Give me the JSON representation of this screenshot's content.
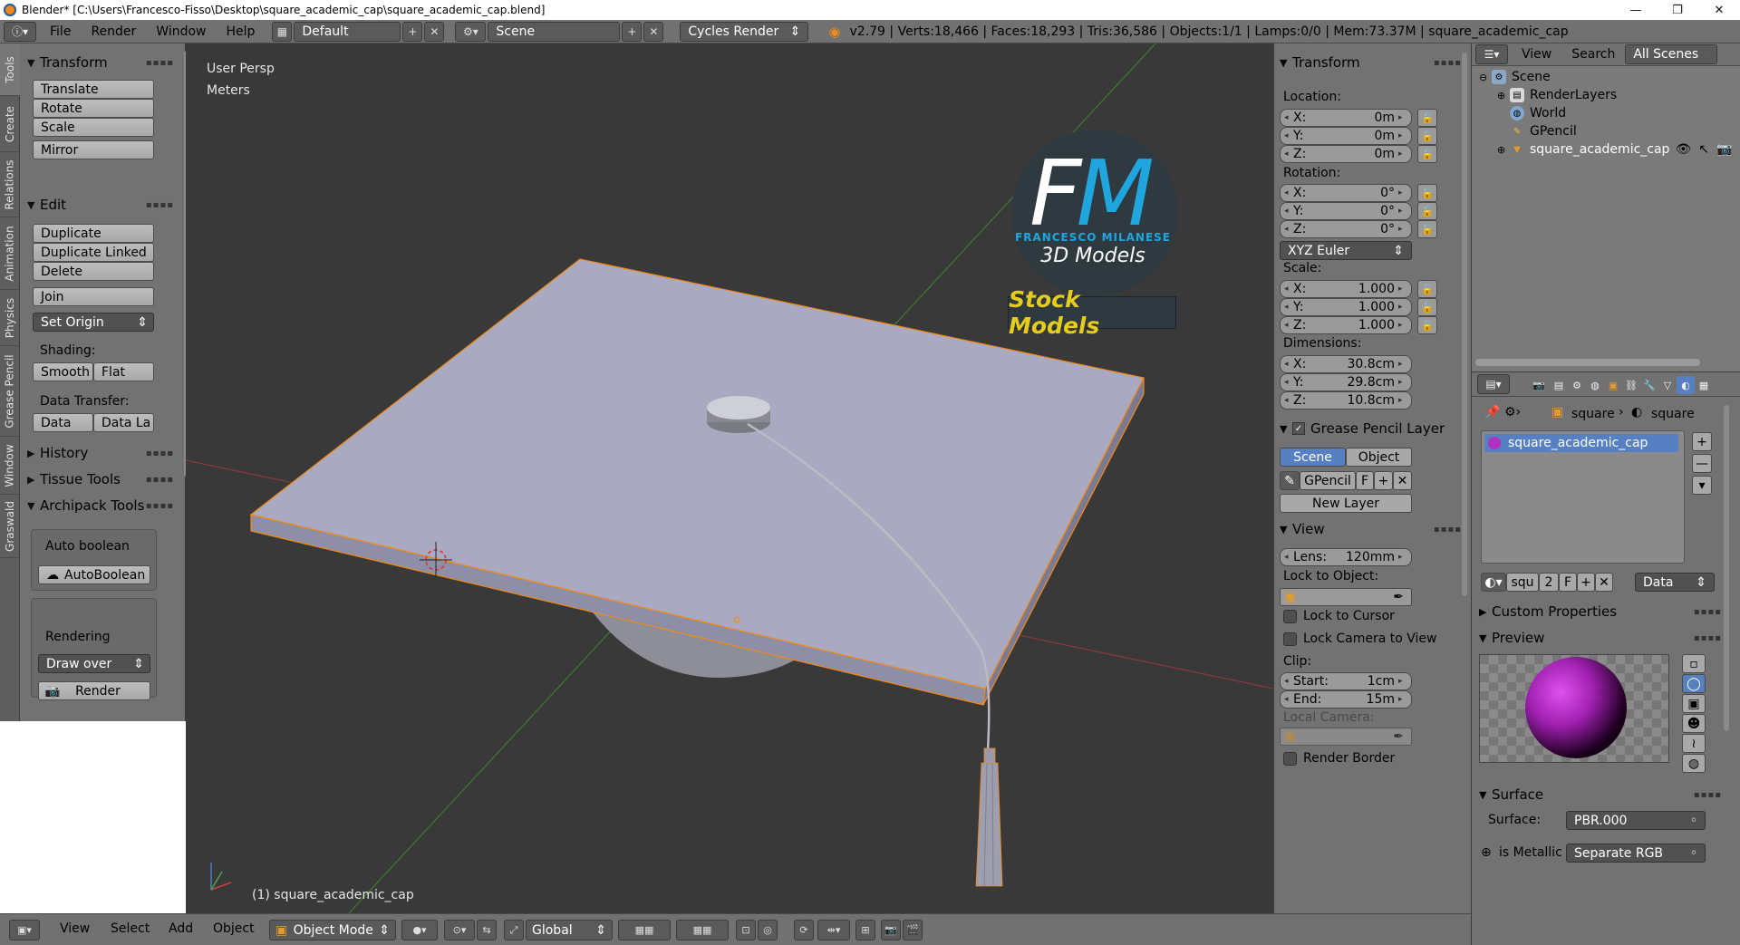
{
  "window": {
    "title": "Blender* [C:\\Users\\Francesco-Fisso\\Desktop\\square_academic_cap\\square_academic_cap.blend]",
    "minimize": "—",
    "maximize": "❐",
    "close": "✕"
  },
  "info_header": {
    "menus": [
      "File",
      "Render",
      "Window",
      "Help"
    ],
    "screen_layout": "Default",
    "scene": "Scene",
    "engine": "Cycles Render",
    "stats": "v2.79 | Verts:18,466 | Faces:18,293 | Tris:36,586 | Objects:1/1 | Lamps:0/0 | Mem:73.37M | square_academic_cap"
  },
  "tool_tabs": [
    "Tools",
    "Create",
    "Relations",
    "Animation",
    "Physics",
    "Grease Pencil",
    "Window",
    "Graswald"
  ],
  "tool_shelf": {
    "transform": {
      "title": "Transform",
      "buttons": [
        "Translate",
        "Rotate",
        "Scale",
        "Mirror"
      ]
    },
    "edit": {
      "title": "Edit",
      "buttons": [
        "Duplicate",
        "Duplicate Linked",
        "Delete",
        "Join"
      ],
      "set_origin": "Set Origin",
      "shading_label": "Shading:",
      "smooth": "Smooth",
      "flat": "Flat",
      "data_transfer_label": "Data Transfer:",
      "data": "Data",
      "data_la": "Data La"
    },
    "history": "History",
    "tissue_tools": "Tissue Tools",
    "archipack": "Archipack Tools",
    "auto_boolean_label": "Auto boolean",
    "auto_boolean_btn": "AutoBoolean",
    "rendering_label": "Rendering",
    "draw_over": "Draw over",
    "render_btn": "Render"
  },
  "viewport": {
    "view_name": "User Persp",
    "units": "Meters",
    "object_label": "(1) square_academic_cap",
    "logo": {
      "brand_letters_f": "F",
      "brand_letters_m": "M",
      "brand_name": "FRANCESCO MILANESE",
      "tagline": "3D Models",
      "stock": "Stock Models"
    },
    "colors": {
      "background": "#393939",
      "cap": "#a9a9c1",
      "cap_side": "#8e8ea6",
      "selection": "#f08a16",
      "x_axis": "#8a3a3a",
      "y_axis": "#3e7a2e"
    }
  },
  "n_panel": {
    "transform_title": "Transform",
    "location_label": "Location:",
    "location": [
      {
        "axis": "X:",
        "value": "0m"
      },
      {
        "axis": "Y:",
        "value": "0m"
      },
      {
        "axis": "Z:",
        "value": "0m"
      }
    ],
    "rotation_label": "Rotation:",
    "rotation": [
      {
        "axis": "X:",
        "value": "0°"
      },
      {
        "axis": "Y:",
        "value": "0°"
      },
      {
        "axis": "Z:",
        "value": "0°"
      }
    ],
    "rotation_mode": "XYZ Euler",
    "scale_label": "Scale:",
    "scale": [
      {
        "axis": "X:",
        "value": "1.000"
      },
      {
        "axis": "Y:",
        "value": "1.000"
      },
      {
        "axis": "Z:",
        "value": "1.000"
      }
    ],
    "dimensions_label": "Dimensions:",
    "dimensions": [
      {
        "axis": "X:",
        "value": "30.8cm"
      },
      {
        "axis": "Y:",
        "value": "29.8cm"
      },
      {
        "axis": "Z:",
        "value": "10.8cm"
      }
    ],
    "grease_pencil_title": "Grease Pencil Layer",
    "gp_scene": "Scene",
    "gp_object": "Object",
    "gp_name": "GPencil",
    "gp_f": "F",
    "new_layer": "New Layer",
    "view_title": "View",
    "lens_label": "Lens:",
    "lens_value": "120mm",
    "lock_to_object": "Lock to Object:",
    "lock_to_cursor": "Lock to Cursor",
    "lock_camera": "Lock Camera to View",
    "clip_label": "Clip:",
    "clip_start_label": "Start:",
    "clip_start": "1cm",
    "clip_end_label": "End:",
    "clip_end": "15m",
    "local_camera": "Local Camera:",
    "render_border": "Render Border"
  },
  "outliner": {
    "menus": [
      "View",
      "Search"
    ],
    "filter": "All Scenes",
    "items": [
      "Scene",
      "RenderLayers",
      "World",
      "GPencil",
      "square_academic_cap"
    ]
  },
  "properties": {
    "breadcrumb_obj": "square",
    "breadcrumb_mat": "square",
    "material_slot": "square_academic_cap",
    "mat_name": "squ",
    "mat_users": "2",
    "mat_f": "F",
    "link": "Data",
    "custom_properties": "Custom Properties",
    "preview": "Preview",
    "surface_title": "Surface",
    "surface_label": "Surface:",
    "surface_value": "PBR.000",
    "is_metallic_label": "is Metallic",
    "is_metallic_value": "Separate RGB"
  },
  "bottom_header": {
    "menus": [
      "View",
      "Select",
      "Add",
      "Object"
    ],
    "mode": "Object Mode",
    "orientation": "Global"
  }
}
